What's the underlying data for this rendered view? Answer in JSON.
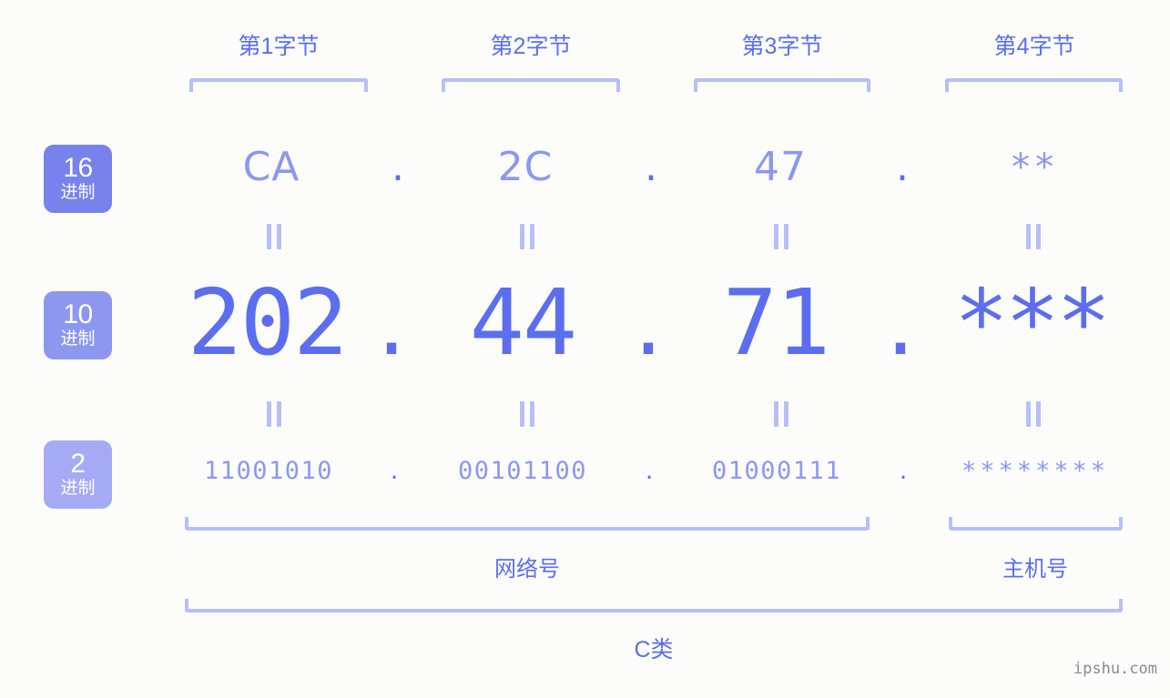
{
  "meta": {
    "background_color": "#fcfdfa",
    "accent_strong": "#5b6ef0",
    "accent_mid": "#8d97f2",
    "accent_light": "#b7bff7",
    "watermark": "ipshu.com"
  },
  "byte_headers": [
    {
      "label": "第1字节"
    },
    {
      "label": "第2字节"
    },
    {
      "label": "第3字节"
    },
    {
      "label": "第4字节"
    }
  ],
  "rows": [
    {
      "badge_number": "16",
      "badge_word": "进制",
      "badge_color": "#7782ec",
      "values": [
        "CA",
        "2C",
        "47",
        "**"
      ],
      "separator": "."
    },
    {
      "badge_number": "10",
      "badge_word": "进制",
      "badge_color": "#8e97f0",
      "values": [
        "202",
        "44",
        "71",
        "***"
      ],
      "separator": "."
    },
    {
      "badge_number": "2",
      "badge_word": "进制",
      "badge_color": "#a4abf4",
      "values": [
        "11001010",
        "00101100",
        "01000111",
        "********"
      ],
      "separator": "."
    }
  ],
  "footer": {
    "network_label": "网络号",
    "host_label": "主机号",
    "class_label": "C类"
  }
}
